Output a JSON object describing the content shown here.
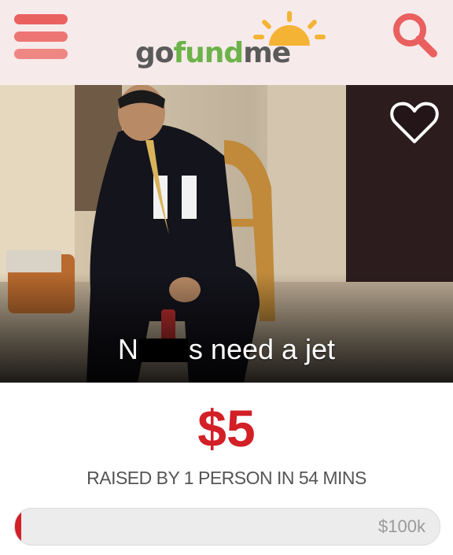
{
  "header": {
    "logo": {
      "part1": "go",
      "part2": "fund",
      "part3": "me"
    },
    "menu_icon": "hamburger-menu-icon",
    "search_icon": "search-icon"
  },
  "campaign": {
    "title_prefix": "N",
    "title_suffix": "s need a jet",
    "favorite_icon": "heart-icon",
    "amount_raised": "$5",
    "raised_info": "RAISED BY 1 PERSON IN 54 MINS",
    "goal": "$100k",
    "progress_fraction": 5e-05
  },
  "colors": {
    "accent_red": "#d31f26",
    "brand_green": "#6bb34a",
    "header_bg": "#f7eaea",
    "menu_coral": "#e9605f"
  }
}
